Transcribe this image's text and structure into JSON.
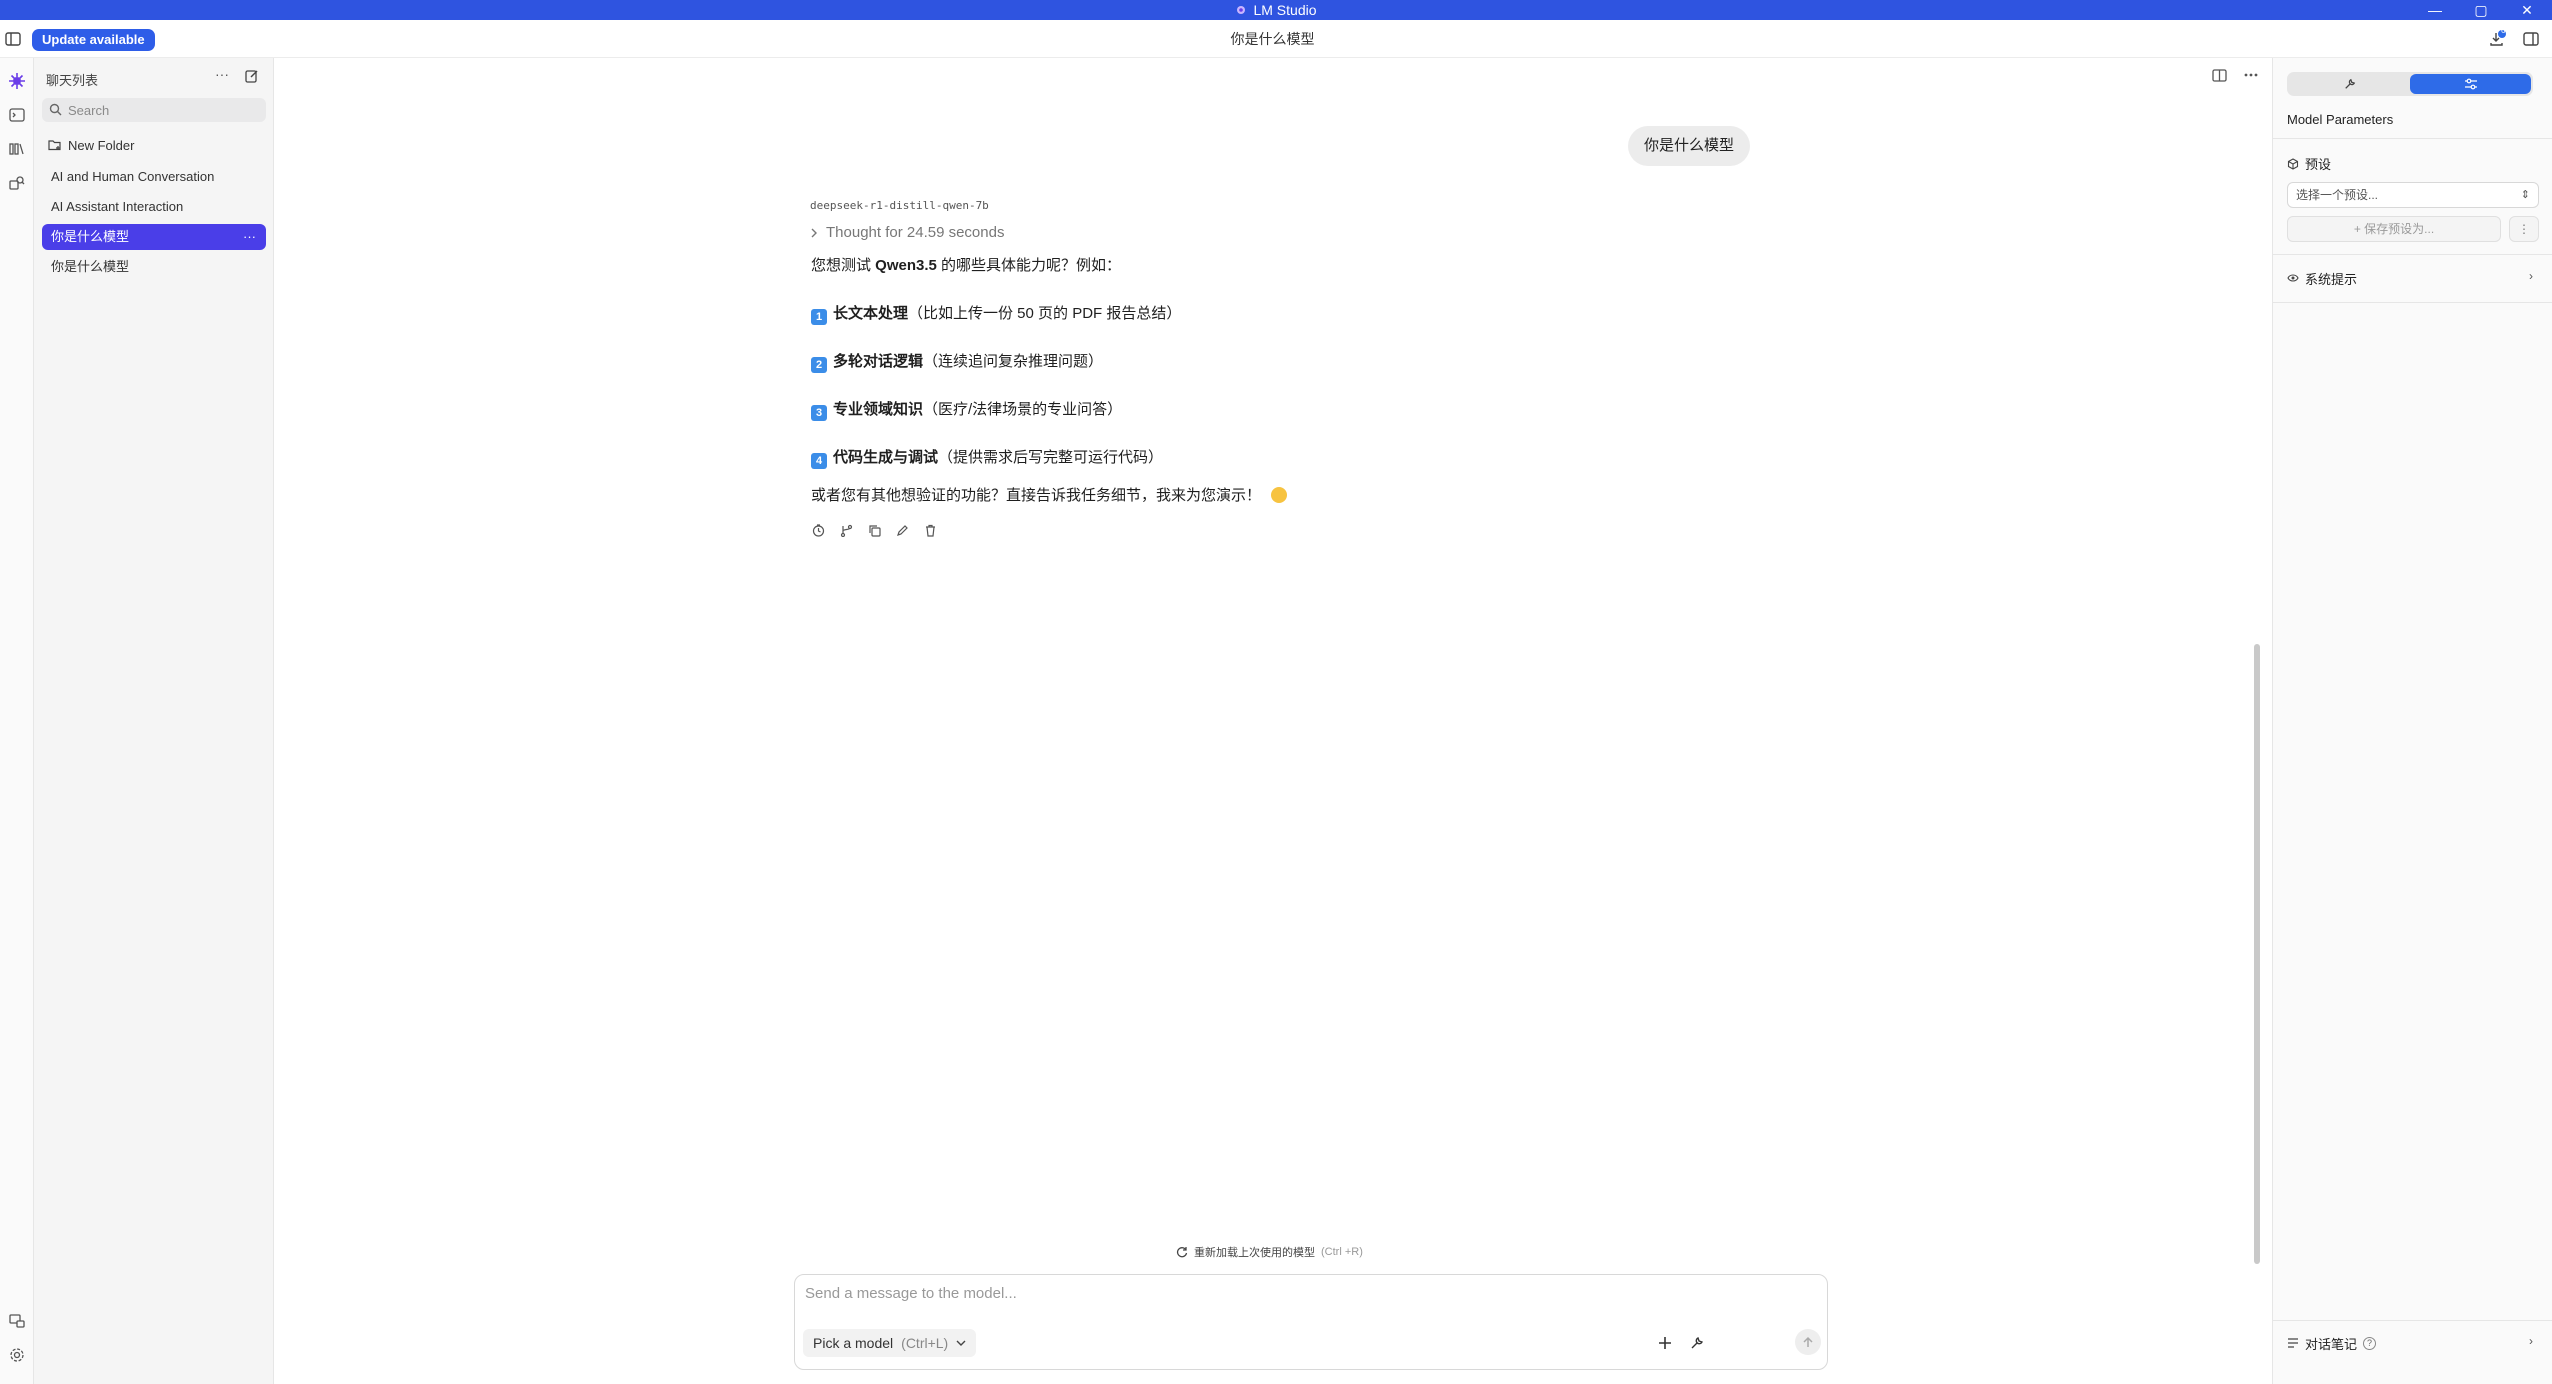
{
  "app": {
    "title": "LM Studio",
    "colors": {
      "titlebar": "#2f54e0",
      "accent": "#4a3ee8",
      "update_button": "#2e5de8",
      "segment_active": "#2e6be8"
    }
  },
  "header": {
    "update_label": "Update available",
    "chat_title": "你是什么模型",
    "download_badge": "6"
  },
  "window_controls": {
    "minimize": "—",
    "maximize": "▢",
    "close": "✕"
  },
  "sidebar": {
    "heading": "聊天列表",
    "more": "···",
    "search_placeholder": "Search",
    "new_folder": "New Folder",
    "items": [
      {
        "label": "AI and Human Conversation"
      },
      {
        "label": "AI Assistant Interaction"
      },
      {
        "label": "你是什么模型",
        "active": true,
        "menu": "···"
      },
      {
        "label": "你是什么模型"
      }
    ]
  },
  "chat": {
    "user_message": "你是什么模型",
    "model_name": "deepseek-r1-distill-qwen-7b",
    "thought": "Thought for 24.59 seconds",
    "intro_prefix": "您想测试 ",
    "intro_bold": "Qwen3.5",
    "intro_suffix": " 的哪些具体能力呢？例如：",
    "list": [
      {
        "num": "1",
        "title": "长文本处理",
        "detail": "（比如上传一份 50 页的 PDF 报告总结）"
      },
      {
        "num": "2",
        "title": "多轮对话逻辑",
        "detail": "（连续追问复杂推理问题）"
      },
      {
        "num": "3",
        "title": "专业领域知识",
        "detail": "（医疗/法律场景的专业问答）"
      },
      {
        "num": "4",
        "title": "代码生成与调试",
        "detail": "（提供需求后写完整可运行代码）"
      }
    ],
    "closing": "或者您有其他想验证的功能？直接告诉我任务细节，我来为您演示！"
  },
  "composer": {
    "reload_label": "重新加载上次使用的模型",
    "reload_shortcut": "(Ctrl +R)",
    "placeholder": "Send a message to the model...",
    "pick_model": "Pick a model",
    "pick_shortcut": "(Ctrl+L)"
  },
  "right_panel": {
    "title": "Model Parameters",
    "preset_section": "预设",
    "preset_select": "选择一个预设...",
    "save_preset": "+ 保存预设为...",
    "save_more": "⋮",
    "system_prompt": "系统提示",
    "notes": "对话笔记",
    "notes_help": "?"
  }
}
